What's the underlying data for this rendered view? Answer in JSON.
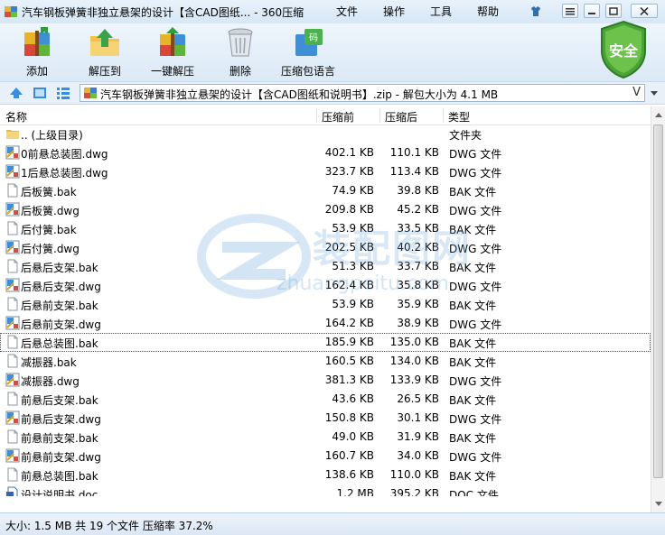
{
  "window": {
    "title": "汽车钢板弹簧非独立悬架的设计【含CAD图纸... - 360压缩",
    "menu": [
      "文件",
      "操作",
      "工具",
      "帮助"
    ]
  },
  "toolbar": {
    "buttons": [
      {
        "label": "添加",
        "icon": "add-books-icon"
      },
      {
        "label": "解压到",
        "icon": "extract-folder-icon"
      },
      {
        "label": "一键解压",
        "icon": "one-click-extract-icon"
      },
      {
        "label": "删除",
        "icon": "trash-bin-icon"
      },
      {
        "label": "压缩包语言",
        "icon": "archive-language-icon"
      }
    ],
    "safe_label": "安全"
  },
  "address": {
    "path": "汽车钢板弹簧非独立悬架的设计【含CAD图纸和说明书】.zip - 解包大小为 4.1 MB",
    "chevron": "V"
  },
  "columns": {
    "name": "名称",
    "size": "压缩前",
    "packed": "压缩后",
    "type": "类型"
  },
  "files": [
    {
      "name": ".. (上级目录)",
      "size": "",
      "packed": "",
      "type": "文件夹",
      "icon": "folder"
    },
    {
      "name": "0前悬总装图.dwg",
      "size": "402.1 KB",
      "packed": "110.1 KB",
      "type": "DWG 文件",
      "icon": "dwg"
    },
    {
      "name": "1后悬总装图.dwg",
      "size": "323.7 KB",
      "packed": "113.4 KB",
      "type": "DWG 文件",
      "icon": "dwg"
    },
    {
      "name": "后板簧.bak",
      "size": "74.9 KB",
      "packed": "39.8 KB",
      "type": "BAK 文件",
      "icon": "bak"
    },
    {
      "name": "后板簧.dwg",
      "size": "209.8 KB",
      "packed": "45.2 KB",
      "type": "DWG 文件",
      "icon": "dwg"
    },
    {
      "name": "后付簧.bak",
      "size": "53.9 KB",
      "packed": "33.5 KB",
      "type": "BAK 文件",
      "icon": "bak"
    },
    {
      "name": "后付簧.dwg",
      "size": "202.5 KB",
      "packed": "40.2 KB",
      "type": "DWG 文件",
      "icon": "dwg"
    },
    {
      "name": "后悬后支架.bak",
      "size": "51.3 KB",
      "packed": "33.7 KB",
      "type": "BAK 文件",
      "icon": "bak"
    },
    {
      "name": "后悬后支架.dwg",
      "size": "162.4 KB",
      "packed": "35.8 KB",
      "type": "DWG 文件",
      "icon": "dwg"
    },
    {
      "name": "后悬前支架.bak",
      "size": "53.9 KB",
      "packed": "35.9 KB",
      "type": "BAK 文件",
      "icon": "bak"
    },
    {
      "name": "后悬前支架.dwg",
      "size": "164.2 KB",
      "packed": "38.9 KB",
      "type": "DWG 文件",
      "icon": "dwg"
    },
    {
      "name": "后悬总装图.bak",
      "size": "185.9 KB",
      "packed": "135.0 KB",
      "type": "BAK 文件",
      "icon": "bak",
      "selected": true
    },
    {
      "name": "减振器.bak",
      "size": "160.5 KB",
      "packed": "134.0 KB",
      "type": "BAK 文件",
      "icon": "bak"
    },
    {
      "name": "减振器.dwg",
      "size": "381.3 KB",
      "packed": "133.9 KB",
      "type": "DWG 文件",
      "icon": "dwg"
    },
    {
      "name": "前悬后支架.bak",
      "size": "43.6 KB",
      "packed": "26.5 KB",
      "type": "BAK 文件",
      "icon": "bak"
    },
    {
      "name": "前悬后支架.dwg",
      "size": "150.8 KB",
      "packed": "30.1 KB",
      "type": "DWG 文件",
      "icon": "dwg"
    },
    {
      "name": "前悬前支架.bak",
      "size": "49.0 KB",
      "packed": "31.9 KB",
      "type": "BAK 文件",
      "icon": "bak"
    },
    {
      "name": "前悬前支架.dwg",
      "size": "160.7 KB",
      "packed": "34.0 KB",
      "type": "DWG 文件",
      "icon": "dwg"
    },
    {
      "name": "前悬总装图.bak",
      "size": "138.6 KB",
      "packed": "110.0 KB",
      "type": "BAK 文件",
      "icon": "bak"
    },
    {
      "name": "设计说明书.doc",
      "size": "1.2 MB",
      "packed": "395.2 KB",
      "type": "DOC 文件",
      "icon": "doc"
    }
  ],
  "status": "大小: 1.5 MB 共 19 个文件 压缩率 37.2%",
  "watermark": {
    "cn": "装配图网",
    "en": "zhuangpeitu.com"
  }
}
